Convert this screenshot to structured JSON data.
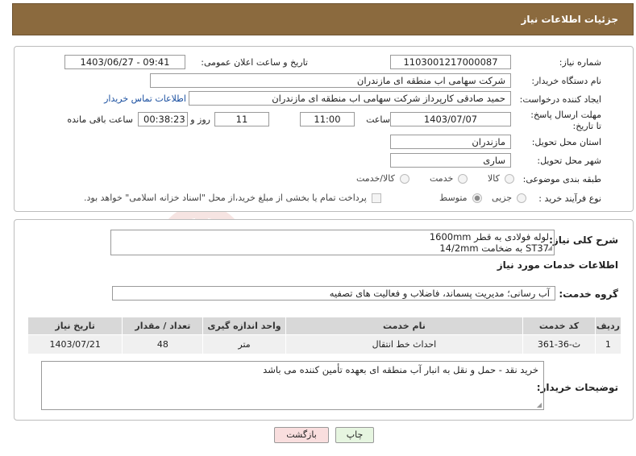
{
  "header": {
    "title": "جزئیات اطلاعات نیاز"
  },
  "fields": {
    "need_number_label": "شماره نیاز:",
    "need_number": "1103001217000087",
    "announce_label": "تاریخ و ساعت اعلان عمومی:",
    "announce_value": "1403/06/27 - 09:41",
    "buyer_org_label": "نام دستگاه خریدار:",
    "buyer_org": "شرکت سهامی اب منطقه ای مازندران",
    "creator_label": "ایجاد کننده درخواست:",
    "creator": "حمید  صادقی کارپرداز شرکت سهامی اب منطقه ای مازندران",
    "contact_link": "اطلاعات تماس خریدار",
    "deadline_label": "مهلت ارسال پاسخ: تا تاریخ:",
    "deadline_date": "1403/07/07",
    "time_label": "ساعت",
    "deadline_time": "11:00",
    "days_value": "11",
    "days_label": "روز و",
    "remaining_time": "00:38:23",
    "remaining_label": "ساعت باقی مانده",
    "province_label": "استان محل تحویل:",
    "province": "مازندران",
    "city_label": "شهر محل تحویل:",
    "city": "ساری",
    "category_label": "طبقه بندی موضوعی:",
    "category_options": [
      "کالا",
      "خدمت",
      "کالا/خدمت"
    ],
    "process_label": "نوع فرآیند خرید :",
    "process_options": [
      "جزیی",
      "متوسط"
    ],
    "payment_note": "پرداخت تمام یا بخشی از مبلغ خرید،از محل \"اسناد خزانه اسلامی\" خواهد بود."
  },
  "summary": {
    "label": "شرح کلی نیاز:",
    "line1": "لوله فولادی به قطر 1600mm",
    "line2": "ST37 به ضخامت 14/2mm",
    "services_title": "اطلاعات خدمات مورد نیاز",
    "group_label": "گروه خدمت:",
    "group_value": "آب رسانی؛ مدیریت پسماند، فاضلاب و فعالیت های تصفیه"
  },
  "table": {
    "headers": [
      "ردیف",
      "کد خدمت",
      "نام خدمت",
      "واحد اندازه گیری",
      "تعداد / مقدار",
      "تاریخ نیاز"
    ],
    "rows": [
      [
        "1",
        "ث-36-361",
        "احداث خط انتقال",
        "متر",
        "48",
        "1403/07/21"
      ]
    ]
  },
  "notes": {
    "label": "توضیحات خریدار:",
    "text": "خرید نقد - حمل و نقل به انبار آب منطقه ای بعهده تأمین کننده می باشد"
  },
  "buttons": {
    "print": "چاپ",
    "back": "بازگشت"
  },
  "watermark": {
    "text": "AriaTender.net"
  },
  "colors": {
    "header_bg": "#8b6a3e",
    "link": "#1a4fa0",
    "back_button_bg": "#f9dede",
    "print_button_bg": "#e6f5e0"
  }
}
